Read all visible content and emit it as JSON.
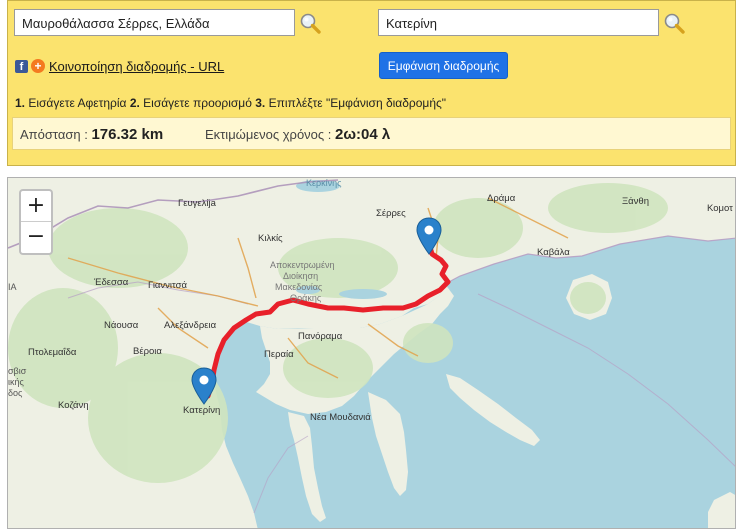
{
  "form": {
    "origin_value": "Μαυροθάλασσα Σέρρες, Ελλάδα",
    "destination_value": "Κατερίνη",
    "share_link": "Κοινοποίηση διαδρομής - URL",
    "show_route_button": "Εμφάνιση διαδρομής",
    "instructions": {
      "step1_num": "1.",
      "step1": "Εισάγετε Αφετηρία",
      "step2_num": "2.",
      "step2": "Εισάγετε προορισμό",
      "step3_num": "3.",
      "step3": "Επιπλέξτε \"Εμφάνιση διαδρομής\""
    },
    "distance_label": "Απόσταση :",
    "distance_value": "176.32 km",
    "time_label": "Εκτιμώμενος χρόνος :",
    "time_value": "2ω:04 λ"
  },
  "map": {
    "zoom_in": "+",
    "zoom_out": "−",
    "route_color": "#e8202a",
    "land_color": "#f2efe9",
    "water_color": "#aad3df",
    "labels": {
      "kerkinis": "Κερκίνης",
      "gevgelija": "Γευγελίja",
      "serres": "Σέρρες",
      "drama": "Δράμα",
      "xanthi": "Ξάνθη",
      "komot": "Κομοτ",
      "kilkis": "Κιλκίς",
      "kavala": "Καβάλα",
      "apokentromeni": "Αποκεντρωμένη",
      "dioikisi": "Διοίκηση",
      "makedonias": "Μακεδονίας",
      "thrakis": "Θράκης",
      "edessa": "Έδεσσα",
      "giannitsa": "Γιαννιτσά",
      "naousa": "Νάουσα",
      "alexandreia": "Αλεξάνδρεια",
      "panorama": "Πανόραμα",
      "perea": "Περαία",
      "ptolemaida": "Πτολεμαΐδα",
      "veroia": "Βέροια",
      "katerini": "Κατερίνη",
      "kozani": "Κοζάνη",
      "nea_moudania": "Νέα Μουδανιά",
      "edge_ia": "ΙΑ",
      "edge_vis": "σβισ",
      "edge_iki": "ικής",
      "edge_dos": "δος"
    }
  }
}
